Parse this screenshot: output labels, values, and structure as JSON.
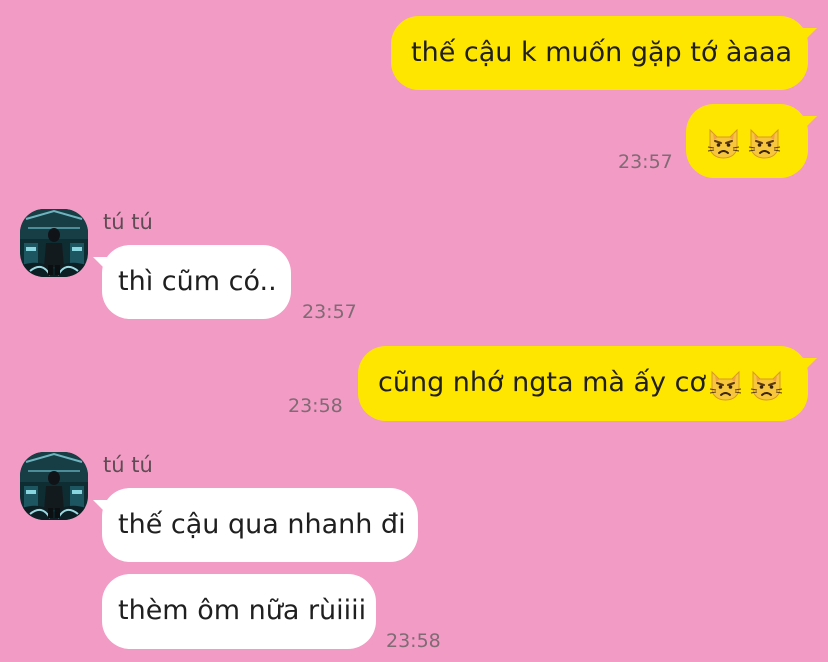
{
  "messages": [
    {
      "id": "m1",
      "side": "out",
      "text": "thế cậu k muốn gặp tớ àaaa"
    },
    {
      "id": "m2",
      "side": "out",
      "emojis": [
        "pouting-cat-icon",
        "pouting-cat-icon"
      ],
      "time": "23:57"
    },
    {
      "id": "m3",
      "side": "in",
      "sender": "tú tú",
      "text": "thì cũm có..",
      "time": "23:57"
    },
    {
      "id": "m4",
      "side": "out",
      "text": "cũng nhớ ngta mà ấy cơ",
      "emojis": [
        "pouting-cat-icon",
        "pouting-cat-icon"
      ],
      "time": "23:58"
    },
    {
      "id": "m5",
      "side": "in",
      "sender": "tú tú",
      "text": "thế cậu qua nhanh đi"
    },
    {
      "id": "m6",
      "side": "in",
      "text": "thèm ôm nữa rùiiii",
      "time": "23:58"
    }
  ],
  "colors": {
    "background": "#f29bc4",
    "outgoing_bubble": "#ffe600",
    "incoming_bubble": "#ffffff",
    "timestamp": "#7e6b74"
  }
}
